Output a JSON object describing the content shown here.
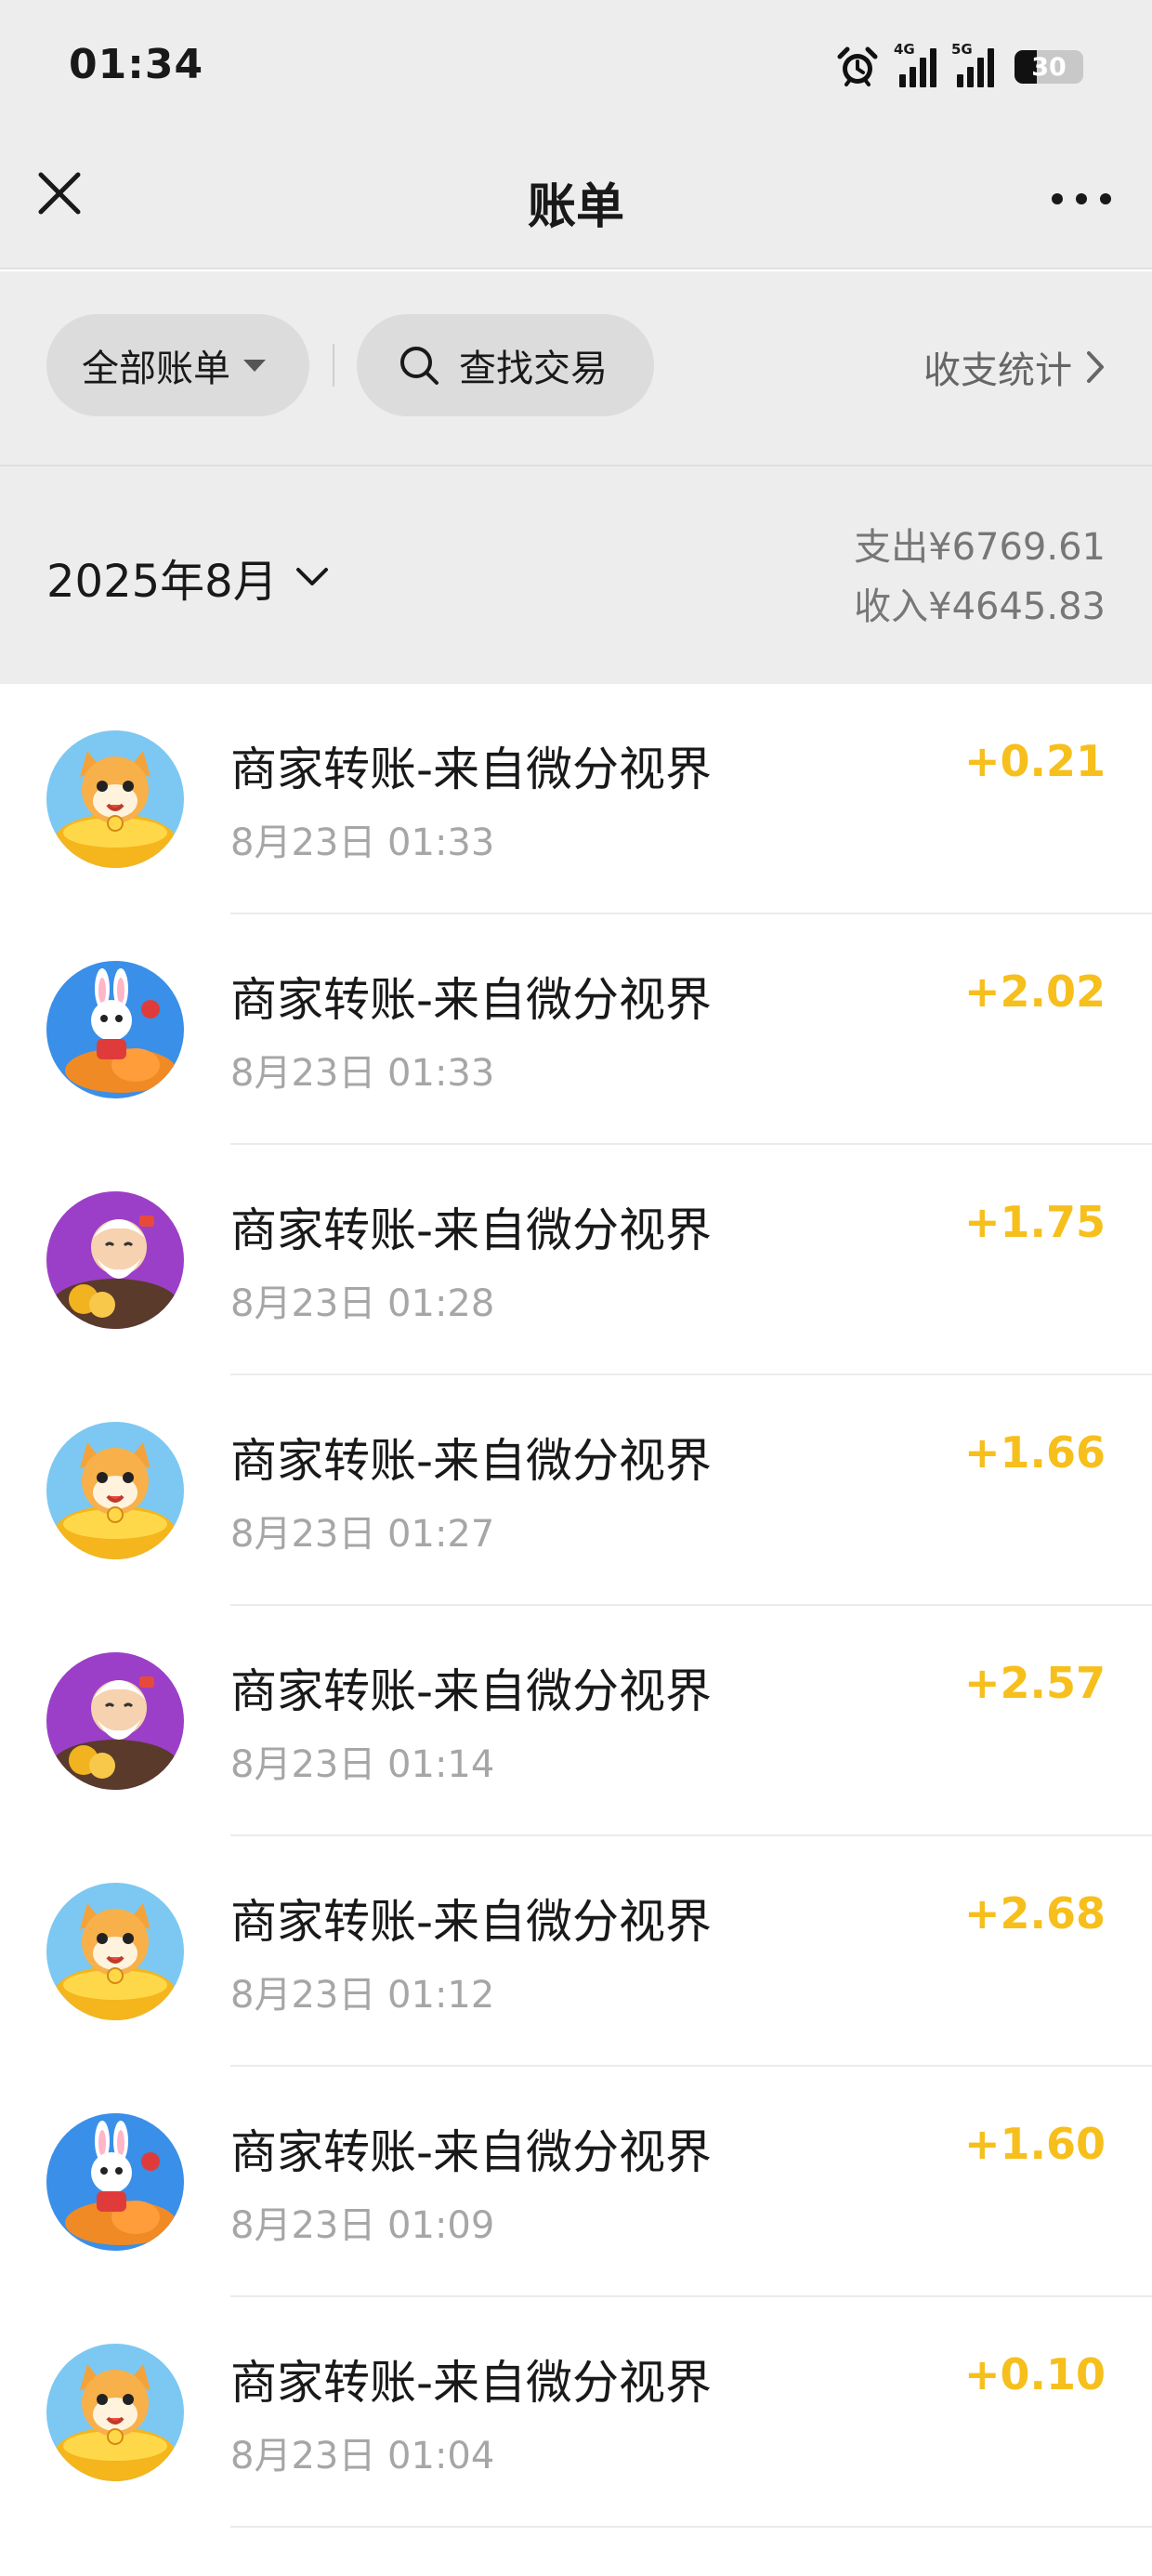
{
  "status_bar": {
    "time": "01:34",
    "net1": "4G",
    "net2": "5G",
    "battery": "30",
    "icons": [
      "alarm-icon",
      "signal-icon",
      "signal-icon",
      "battery-icon"
    ]
  },
  "nav": {
    "title": "账单",
    "close_icon": "close-icon",
    "more_icon": "more-icon"
  },
  "filter": {
    "all_bills": "全部账单",
    "search": "查找交易",
    "stats": "收支统计"
  },
  "summary": {
    "month": "2025年8月",
    "expense": "支出¥6769.61",
    "income": "收入¥4645.83"
  },
  "colors": {
    "income_amount": "#f6bf1c",
    "background": "#ededed"
  },
  "transactions": [
    {
      "title": "商家转账-来自微分视界",
      "time": "8月23日 01:33",
      "amount": "+0.21",
      "avatar": "cat"
    },
    {
      "title": "商家转账-来自微分视界",
      "time": "8月23日 01:33",
      "amount": "+2.02",
      "avatar": "rabbit"
    },
    {
      "title": "商家转账-来自微分视界",
      "time": "8月23日 01:28",
      "amount": "+1.75",
      "avatar": "old-man"
    },
    {
      "title": "商家转账-来自微分视界",
      "time": "8月23日 01:27",
      "amount": "+1.66",
      "avatar": "cat"
    },
    {
      "title": "商家转账-来自微分视界",
      "time": "8月23日 01:14",
      "amount": "+2.57",
      "avatar": "old-man"
    },
    {
      "title": "商家转账-来自微分视界",
      "time": "8月23日 01:12",
      "amount": "+2.68",
      "avatar": "cat"
    },
    {
      "title": "商家转账-来自微分视界",
      "time": "8月23日 01:09",
      "amount": "+1.60",
      "avatar": "rabbit"
    },
    {
      "title": "商家转账-来自微分视界",
      "time": "8月23日 01:04",
      "amount": "+0.10",
      "avatar": "cat"
    }
  ]
}
